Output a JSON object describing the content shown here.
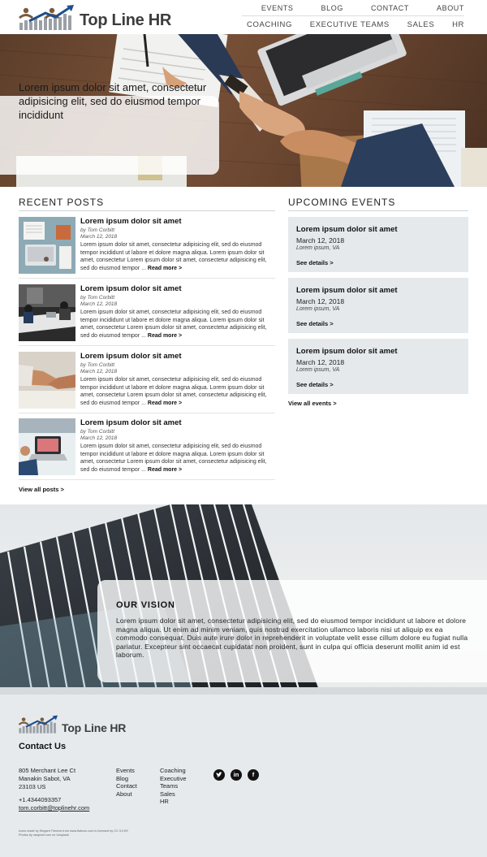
{
  "brand": {
    "name_part1": "Top Line",
    "name_part2": "HR"
  },
  "nav": {
    "top": [
      "EVENTS",
      "BLOG",
      "CONTACT",
      "ABOUT"
    ],
    "main": [
      "COACHING",
      "EXECUTIVE TEAMS",
      "SALES",
      "HR"
    ]
  },
  "hero": {
    "text": "Lorem ipsum dolor sit amet, consectetur adipisicing elit, sed do eiusmod tempor incididunt"
  },
  "recent_posts": {
    "title": "RECENT POSTS",
    "posts": [
      {
        "title": "Lorem ipsum dolor sit amet",
        "author": "by Tom Corbitt",
        "date": "March 12, 2018",
        "excerpt": "Lorem ipsum dolor sit amet, consectetur adipisicing elit, sed do eiusmod tempor incididunt ut labore et dolore magna aliqua. Lorem ipsum dolor sit amet, consectetur Lorem ipsum dolor sit amet, consectetur adipisicing elit, sed do eiusmod tempor ...",
        "read_more": "Read more >"
      },
      {
        "title": "Lorem ipsum dolor sit amet",
        "author": "by Tom Corbitt",
        "date": "March 12, 2018",
        "excerpt": "Lorem ipsum dolor sit amet, consectetur adipisicing elit, sed do eiusmod tempor incididunt ut labore et dolore magna aliqua. Lorem ipsum dolor sit amet, consectetur Lorem ipsum dolor sit amet, consectetur adipisicing elit, sed do eiusmod tempor ...",
        "read_more": "Read more >"
      },
      {
        "title": "Lorem ipsum dolor sit amet",
        "author": "by Tom Corbitt",
        "date": "March 12, 2018",
        "excerpt": "Lorem ipsum dolor sit amet, consectetur adipisicing elit, sed do eiusmod tempor incididunt ut labore et dolore magna aliqua. Lorem ipsum dolor sit amet, consectetur Lorem ipsum dolor sit amet, consectetur adipisicing elit, sed do eiusmod tempor ...",
        "read_more": "Read more >"
      },
      {
        "title": "Lorem ipsum dolor sit amet",
        "author": "by Tom Corbitt",
        "date": "March 12, 2018",
        "excerpt": "Lorem ipsum dolor sit amet, consectetur adipisicing elit, sed do eiusmod tempor incididunt ut labore et dolore magna aliqua. Lorem ipsum dolor sit amet, consectetur Lorem ipsum dolor sit amet, consectetur adipisicing elit, sed do eiusmod tempor ...",
        "read_more": "Read more >"
      }
    ],
    "view_all": "View all posts >"
  },
  "events": {
    "title": "UPCOMING EVENTS",
    "items": [
      {
        "title": "Lorem ipsum dolor sit amet",
        "date": "March 12, 2018",
        "location": "Lorem ipsum, VA",
        "details": "See details >"
      },
      {
        "title": "Lorem ipsum dolor sit amet",
        "date": "March 12, 2018",
        "location": "Lorem ipsum, VA",
        "details": "See details >"
      },
      {
        "title": "Lorem ipsum dolor sit amet",
        "date": "March 12, 2018",
        "location": "Lorem ipsum, VA",
        "details": "See details >"
      }
    ],
    "view_all": "View all events >"
  },
  "vision": {
    "title": "OUR VISION",
    "text": "Lorem ipsum dolor sit amet, consectetur adipisicing elit, sed do eiusmod tempor incididunt ut labore et dolore magna aliqua. Ut enim ad minim veniam, quis nostrud exercitation ullamco laboris nisi ut aliquip ex ea commodo consequat. Duis aute irure dolor in reprehenderit in voluptate velit esse cillum dolore eu fugiat nulla pariatur. Excepteur sint occaecat cupidatat non proident, sunt in culpa qui officia deserunt mollit anim id est laborum."
  },
  "footer": {
    "contact_title": "Contact Us",
    "address_line1": "805 Merchant Lee Ct",
    "address_line2": "Manakin Sabot, VA",
    "address_line3": "23103 US",
    "phone": "+1.4344093357",
    "email": "tom.corbitt@toplinehr.com",
    "col1": [
      "Events",
      "Blog",
      "Contact",
      "About"
    ],
    "col2": [
      "Coaching",
      "Executive Teams",
      "Sales",
      "HR"
    ],
    "social_icons": [
      "twitter-icon",
      "linkedin-icon",
      "facebook-icon"
    ],
    "credit_line1": "Icons made by Elegant Themes from www.flaticon.com is licensed by CC 3.0 BY",
    "credit_line2": "Photos by rawpixel.com on Unsplash"
  },
  "colors": {
    "accent_blue": "#1f4e8c",
    "logo_gray": "#3d3d3d",
    "event_bg": "#e5e9ec",
    "footer_bg": "#e6eaed"
  }
}
